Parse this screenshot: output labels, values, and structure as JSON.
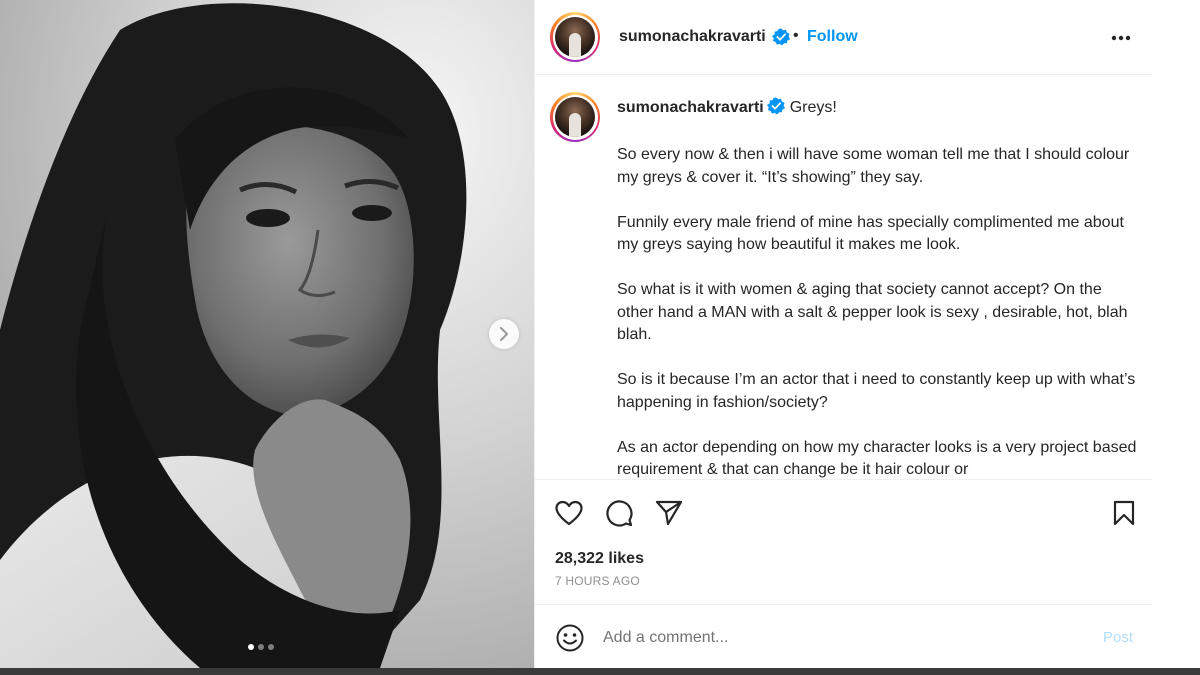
{
  "post": {
    "username": "sumonachakravarti",
    "follow_label": "Follow",
    "separator": "•",
    "caption": {
      "title": "Greys!",
      "paragraphs": [
        "So every now & then i will have some woman tell me that I should colour my greys & cover it. “It’s showing” they say.",
        "Funnily every male friend of mine has specially complimented me about my greys saying how beautiful it makes me look.",
        "So what is it with women & aging that society cannot accept? On the other hand a MAN with a salt & pepper look is sexy , desirable, hot, blah blah.",
        "So is it because I’m an actor that i need to constantly keep up with what’s happening in fashion/society?",
        "As an actor depending on how my character looks is a very project based requirement & that can change be it hair colour or"
      ]
    },
    "likes": "28,322 likes",
    "timestamp": "7 HOURS AGO",
    "comment_placeholder": "Add a comment...",
    "post_label": "Post",
    "carousel": {
      "slide_count": 3,
      "active_index": 0
    }
  },
  "colors": {
    "accent_blue": "#0095f6",
    "verified_blue": "#0095f6",
    "post_disabled": "#b2dffc",
    "text": "#262626",
    "muted": "#8e8e8e"
  },
  "icons": {
    "like": "heart-icon",
    "comment": "comment-icon",
    "share": "paper-plane-icon",
    "save": "bookmark-icon",
    "more": "more-options-icon",
    "emoji": "emoji-icon",
    "next": "chevron-right-icon",
    "verified": "verified-badge-icon"
  }
}
